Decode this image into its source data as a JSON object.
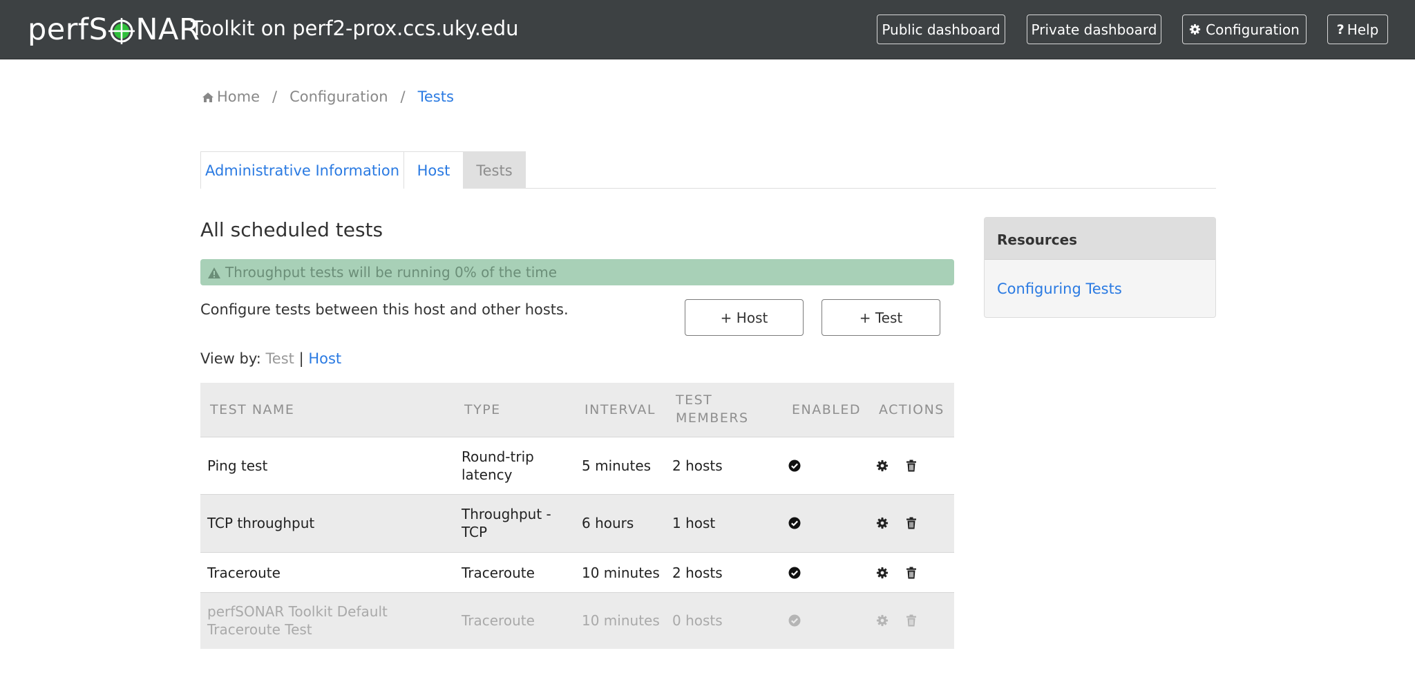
{
  "brand": {
    "logo_prefix": "perfS",
    "logo_suffix": "NAR",
    "site_title": "Toolkit on perf2-prox.ccs.uky.edu"
  },
  "nav": {
    "public_dashboard": "Public dashboard",
    "private_dashboard": "Private dashboard",
    "configuration": "Configuration",
    "help": "Help"
  },
  "breadcrumb": {
    "home": "Home",
    "configuration": "Configuration",
    "tests": "Tests",
    "separator": "/"
  },
  "tabs": [
    {
      "label": "Administrative Information"
    },
    {
      "label": "Host"
    },
    {
      "label": "Tests"
    }
  ],
  "main": {
    "title": "All scheduled tests",
    "alert": "Throughput tests will be running 0% of the time",
    "intro": "Configure tests between this host and other hosts.",
    "add_host": "+ Host",
    "add_test": "+ Test",
    "viewby_label": "View by:",
    "viewby_test": "Test",
    "viewby_sep": "|",
    "viewby_host": "Host"
  },
  "table": {
    "headers": {
      "name": "TEST NAME",
      "type": "TYPE",
      "interval": "INTERVAL",
      "members_1": "TEST",
      "members_2": "MEMBERS",
      "enabled": "ENABLED",
      "actions": "ACTIONS"
    },
    "rows": [
      {
        "name_1": "Ping test",
        "name_2": "",
        "type_1": "Round-trip",
        "type_2": "latency",
        "interval": "5 minutes",
        "members": "2 hosts",
        "enabled": true
      },
      {
        "name_1": "TCP throughput",
        "name_2": "",
        "type_1": "Throughput -",
        "type_2": "TCP",
        "interval": "6 hours",
        "members": "1 host",
        "enabled": true
      },
      {
        "name_1": "Traceroute",
        "name_2": "",
        "type_1": "Traceroute",
        "type_2": "",
        "interval": "10 minutes",
        "members": "2 hosts",
        "enabled": true
      },
      {
        "name_1": "perfSONAR Toolkit Default",
        "name_2": "Traceroute Test",
        "type_1": "Traceroute",
        "type_2": "",
        "interval": "10 minutes",
        "members": "0 hosts",
        "enabled": false
      }
    ]
  },
  "resources": {
    "title": "Resources",
    "link": "Configuring Tests"
  },
  "colors": {
    "navbar": "#3d4143",
    "link": "#2a7ae2",
    "alert_bg": "#a8d0b7",
    "logo_target": "#2fbf3a"
  }
}
